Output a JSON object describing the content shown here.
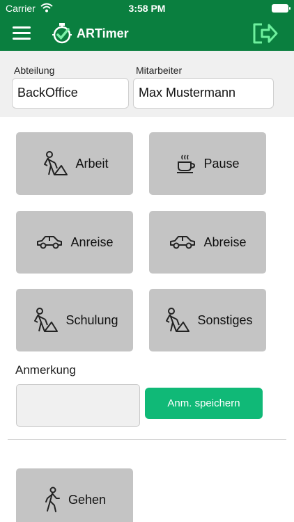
{
  "status_bar": {
    "carrier": "Carrier",
    "time": "3:58 PM"
  },
  "app_bar": {
    "logo_text": "ARTimer"
  },
  "header": {
    "department_label": "Abteilung",
    "department_value": "BackOffice",
    "employee_label": "Mitarbeiter",
    "employee_value": "Max Mustermann"
  },
  "tiles": [
    {
      "label": "Arbeit",
      "icon": "worker-icon"
    },
    {
      "label": "Pause",
      "icon": "coffee-cup-icon"
    },
    {
      "label": "Anreise",
      "icon": "car-icon"
    },
    {
      "label": "Abreise",
      "icon": "car-icon"
    },
    {
      "label": "Schulung",
      "icon": "worker-icon"
    },
    {
      "label": "Sonstiges",
      "icon": "worker-icon"
    },
    {
      "label": "Gehen",
      "icon": "walking-person-icon"
    }
  ],
  "note": {
    "label": "Anmerkung",
    "value": "",
    "save_label": "Anm. speichern"
  },
  "colors": {
    "header_green": "#0a7f3f",
    "button_green": "#10b977",
    "tile_gray": "#c4c4c4"
  }
}
